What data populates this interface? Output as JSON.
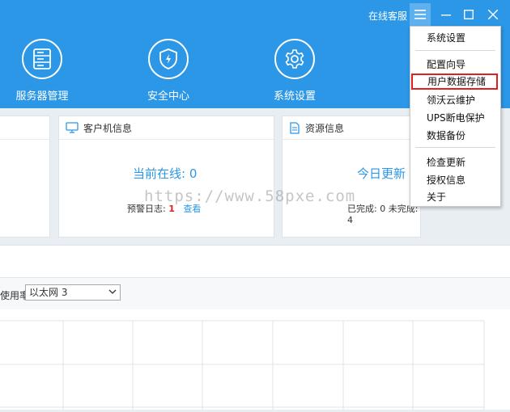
{
  "header": {
    "online_service": "在线客服",
    "nav": [
      {
        "label": "服务器管理",
        "icon": "server-icon"
      },
      {
        "label": "安全中心",
        "icon": "shield-icon"
      },
      {
        "label": "系统设置",
        "icon": "gear-icon"
      }
    ]
  },
  "panels": {
    "client": {
      "title": "客户机信息",
      "online": "当前在线: 0",
      "alert_label": "预警日志:",
      "alert_value": "1",
      "view": "查看"
    },
    "resource": {
      "title": "资源信息",
      "today": "今日更新",
      "status": "已完成: 0 未完成: 4"
    }
  },
  "usage": {
    "label": "使用率",
    "select_value": "以太网 3"
  },
  "menu": {
    "items": [
      {
        "label": "系统设置",
        "highlight": false
      },
      {
        "label": "配置向导",
        "highlight": false
      },
      {
        "label": "用户数据存储",
        "highlight": true
      },
      {
        "label": "领沃云维护",
        "highlight": false
      },
      {
        "label": "UPS断电保护",
        "highlight": false
      },
      {
        "label": "数据备份",
        "highlight": false
      },
      {
        "label": "检查更新",
        "highlight": false
      },
      {
        "label": "授权信息",
        "highlight": false
      },
      {
        "label": "关于",
        "highlight": false
      }
    ]
  },
  "watermark": "https://www.58pxe.com",
  "colors": {
    "accent": "#2b97e6",
    "highlight_border": "#e02020"
  }
}
